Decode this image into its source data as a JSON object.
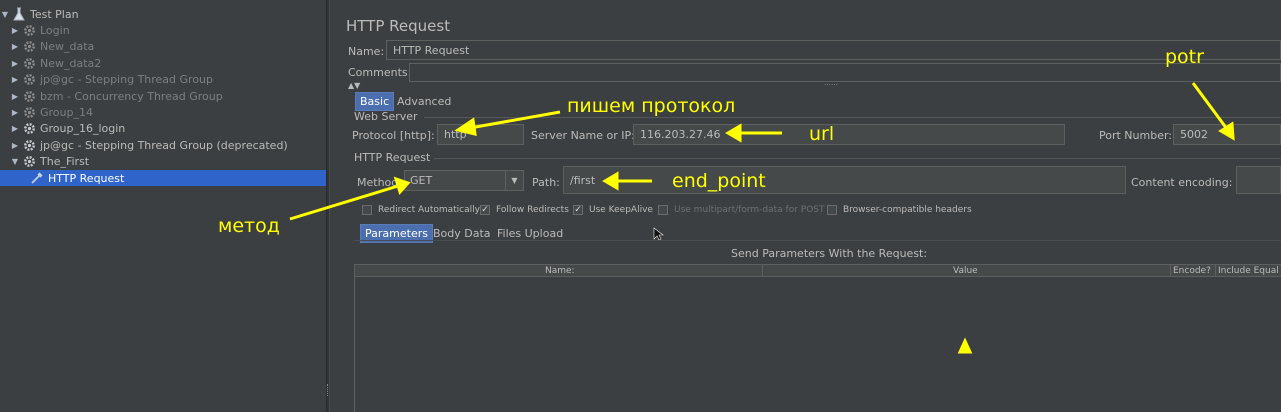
{
  "tree": {
    "items": [
      {
        "label": "Test Plan",
        "icon": "test-plan-icon",
        "arrow": "expanded",
        "level": 0,
        "state": "normal"
      },
      {
        "label": "Login",
        "icon": "thread-group-gear-icon",
        "arrow": "collapsed",
        "level": 1,
        "state": "disabled"
      },
      {
        "label": "New_data",
        "icon": "thread-group-gear-icon",
        "arrow": "collapsed",
        "level": 1,
        "state": "disabled"
      },
      {
        "label": "New_data2",
        "icon": "thread-group-gear-icon",
        "arrow": "collapsed",
        "level": 1,
        "state": "disabled"
      },
      {
        "label": "jp@gc - Stepping Thread Group",
        "icon": "thread-group-gear-icon",
        "arrow": "collapsed",
        "level": 1,
        "state": "disabled"
      },
      {
        "label": "bzm - Concurrency Thread Group",
        "icon": "thread-group-gear-icon",
        "arrow": "collapsed",
        "level": 1,
        "state": "disabled"
      },
      {
        "label": "Group_14",
        "icon": "thread-group-gear-icon",
        "arrow": "collapsed",
        "level": 1,
        "state": "disabled"
      },
      {
        "label": "Group_16_login",
        "icon": "thread-group-gear-icon",
        "arrow": "collapsed",
        "level": 1,
        "state": "normal"
      },
      {
        "label": "jp@gc - Stepping Thread Group (deprecated)",
        "icon": "thread-group-gear-icon",
        "arrow": "collapsed",
        "level": 1,
        "state": "normal"
      },
      {
        "label": "The_First",
        "icon": "thread-group-gear-icon",
        "arrow": "expanded",
        "level": 1,
        "state": "normal"
      },
      {
        "label": "HTTP Request",
        "icon": "http-sampler-pipette-icon",
        "arrow": "none",
        "level": 2,
        "state": "selected"
      }
    ]
  },
  "editor": {
    "title": "HTTP Request",
    "name_label": "Name:",
    "name_value": "HTTP Request",
    "comments_label": "Comments:",
    "collapse_dots": "……",
    "tabs": {
      "basic": "Basic",
      "advanced": "Advanced"
    },
    "web_server": {
      "section": "Web Server",
      "protocol_label": "Protocol [http]:",
      "protocol_value": "http",
      "server_label": "Server Name or IP:",
      "server_value": "116.203.27.46",
      "port_label": "Port Number:",
      "port_value": "5002"
    },
    "http_request": {
      "section": "HTTP Request",
      "method_label": "Method:",
      "method_value": "GET",
      "path_label": "Path:",
      "path_value": "/first",
      "encoding_label": "Content encoding:",
      "encoding_value": ""
    },
    "options": {
      "redirect_automatically": "Redirect Automatically",
      "follow_redirects": "Follow Redirects",
      "use_keepalive": "Use KeepAlive",
      "use_multipart": "Use multipart/form-data for POST",
      "browser_headers": "Browser-compatible headers"
    },
    "sub_tabs": {
      "parameters": "Parameters",
      "body_data": "Body Data",
      "files_upload": "Files Upload"
    },
    "params": {
      "caption": "Send Parameters With the Request:",
      "columns": {
        "name": "Name:",
        "value": "Value",
        "encode": "Encode?",
        "include_equals": "Include Equal"
      }
    }
  },
  "annotations": {
    "protocol": "пишем протокол",
    "url": "url",
    "port": "potr",
    "endpoint": "end_point",
    "method": "метод",
    "color": "#ffff00"
  },
  "colors": {
    "background": "#3c3f41",
    "selection": "#2f65ca",
    "active_tab": "#4b6eaf",
    "field": "#45494a"
  }
}
